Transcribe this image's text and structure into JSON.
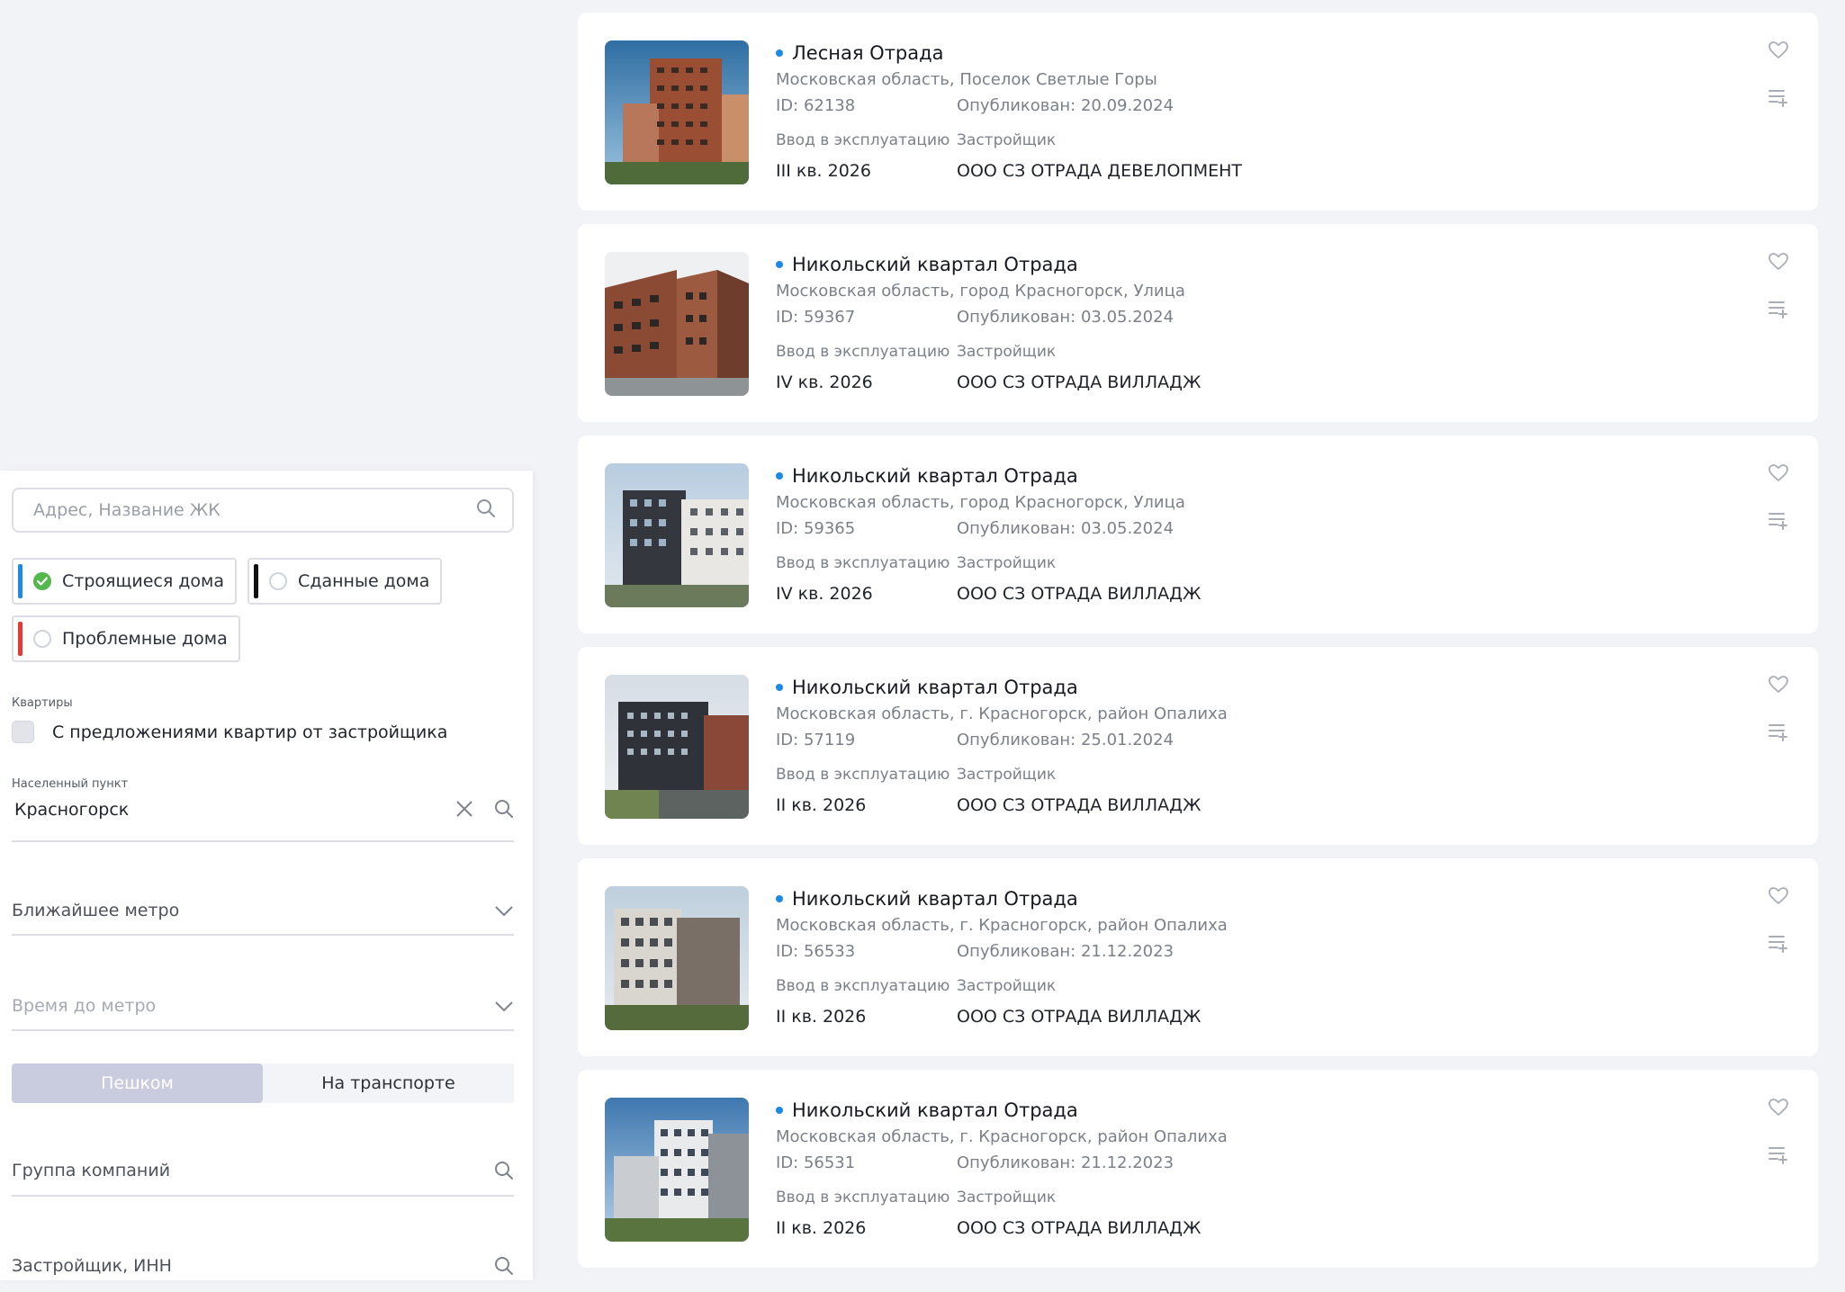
{
  "sidebar": {
    "search_placeholder": "Адрес, Название ЖК",
    "status_filters": [
      {
        "label": "Строящиеся дома",
        "color": "#1e88e5",
        "checked": true
      },
      {
        "label": "Сданные дома",
        "color": "#111111",
        "checked": false
      },
      {
        "label": "Проблемные дома",
        "color": "#e53935",
        "checked": false
      }
    ],
    "apartments_caption": "Квартиры",
    "apartments_checkbox_label": "С предложениями квартир от застройщика",
    "locality_caption": "Населенный пункт",
    "locality_value": "Красногорск",
    "metro_placeholder": "Ближайшее метро",
    "metro_time_placeholder": "Время до метро",
    "travel_mode": {
      "walk": "Пешком",
      "transport": "На транспорте",
      "selected": "walk"
    },
    "group_placeholder": "Группа компаний",
    "developer_placeholder": "Застройщик, ИНН"
  },
  "labels": {
    "commissioning": "Ввод в эксплуатацию",
    "developer": "Застройщик"
  },
  "listings": [
    {
      "title": "Лесная Отрада",
      "address": "Московская область, Поселок Светлые Горы",
      "id_text": "ID: 62138",
      "published": "Опубликован: 20.09.2024",
      "commissioning": "III кв. 2026",
      "developer": "ООО СЗ ОТРАДА ДЕВЕЛОПМЕНТ"
    },
    {
      "title": "Никольский квартал Отрада",
      "address": "Московская область, город Красногорск, Улица",
      "id_text": "ID: 59367",
      "published": "Опубликован: 03.05.2024",
      "commissioning": "IV кв. 2026",
      "developer": "ООО СЗ ОТРАДА ВИЛЛАДЖ"
    },
    {
      "title": "Никольский квартал Отрада",
      "address": "Московская область, город Красногорск, Улица",
      "id_text": "ID: 59365",
      "published": "Опубликован: 03.05.2024",
      "commissioning": "IV кв. 2026",
      "developer": "ООО СЗ ОТРАДА ВИЛЛАДЖ"
    },
    {
      "title": "Никольский квартал Отрада",
      "address": "Московская область, г. Красногорск, район Опалиха",
      "id_text": "ID: 57119",
      "published": "Опубликован: 25.01.2024",
      "commissioning": "II кв. 2026",
      "developer": "ООО СЗ ОТРАДА ВИЛЛАДЖ"
    },
    {
      "title": "Никольский квартал Отрада",
      "address": "Московская область, г. Красногорск, район Опалиха",
      "id_text": "ID: 56533",
      "published": "Опубликован: 21.12.2023",
      "commissioning": "II кв. 2026",
      "developer": "ООО СЗ ОТРАДА ВИЛЛАДЖ"
    },
    {
      "title": "Никольский квартал Отрада",
      "address": "Московская область, г. Красногорск, район Опалиха",
      "id_text": "ID: 56531",
      "published": "Опубликован: 21.12.2023",
      "commissioning": "II кв. 2026",
      "developer": "ООО СЗ ОТРАДА ВИЛЛАДЖ"
    }
  ],
  "colors": {
    "accent": "#1e88e5",
    "check": "#54b84c",
    "toggle_active": "#c9ccdf"
  },
  "icons": {
    "search": "search-icon",
    "clear": "close-icon",
    "chevron": "chevron-down-icon",
    "favorite": "heart-icon",
    "compare": "add-to-list-icon"
  }
}
